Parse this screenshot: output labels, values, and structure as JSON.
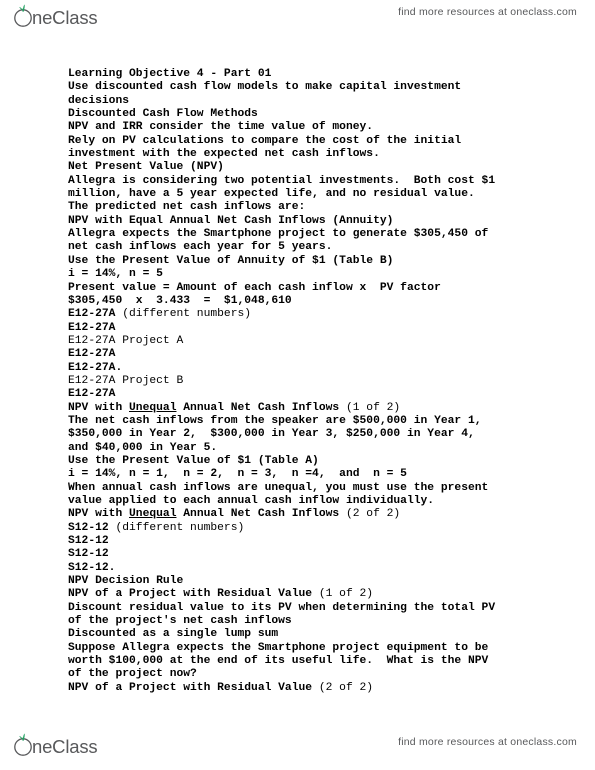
{
  "header": {
    "logo_text": "OneClass",
    "logo_icon": "oneclass-leaf-logo",
    "leaf_color": "#1f9f5f",
    "wordmark_color": "#58595b",
    "tagline": "find more resources at oneclass.com"
  },
  "footer": {
    "logo_text": "OneClass",
    "logo_icon": "oneclass-leaf-logo",
    "leaf_color": "#1f9f5f",
    "wordmark_color": "#58595b",
    "tagline": "find more resources at oneclass.com"
  },
  "document": {
    "lines": [
      {
        "style": "bold",
        "text": "Learning Objective 4 - Part 01"
      },
      {
        "style": "bold",
        "text": "Use discounted cash flow models to make capital investment"
      },
      {
        "style": "bold",
        "text": "decisions"
      },
      {
        "style": "bold",
        "text": "Discounted Cash Flow Methods"
      },
      {
        "style": "bold",
        "text": "NPV and IRR consider the time value of money."
      },
      {
        "style": "bold",
        "text": "Rely on PV calculations to compare the cost of the initial"
      },
      {
        "style": "bold",
        "text": "investment with the expected net cash inflows."
      },
      {
        "style": "bold",
        "text": "Net Present Value (NPV)"
      },
      {
        "style": "bold",
        "text": "Allegra is considering two potential investments.  Both cost $1"
      },
      {
        "style": "bold",
        "text": "million, have a 5 year expected life, and no residual value."
      },
      {
        "style": "bold",
        "text": "The predicted net cash inflows are:"
      },
      {
        "style": "bold",
        "text": "NPV with Equal Annual Net Cash Inflows (Annuity)"
      },
      {
        "style": "bold",
        "text": "Allegra expects the Smartphone project to generate $305,450 of"
      },
      {
        "style": "bold",
        "text": "net cash inflows each year for 5 years."
      },
      {
        "style": "bold",
        "text": "Use the Present Value of Annuity of $1 (Table B)"
      },
      {
        "style": "bold",
        "text": "i = 14%, n = 5"
      },
      {
        "style": "bold",
        "text": "Present value = Amount of each cash inflow x  PV factor"
      },
      {
        "style": "bold",
        "text": "$305,450  x  3.433  =  $1,048,610"
      },
      {
        "style": "mixed",
        "parts": [
          {
            "w": "bold",
            "text": "E12-27A "
          },
          {
            "w": "reg",
            "text": "(different numbers)"
          }
        ]
      },
      {
        "style": "bold",
        "text": "E12-27A"
      },
      {
        "style": "plain",
        "text": "E12-27A Project A"
      },
      {
        "style": "bold",
        "text": "E12-27A"
      },
      {
        "style": "bold",
        "text": "E12-27A."
      },
      {
        "style": "plain",
        "text": "E12-27A Project B"
      },
      {
        "style": "bold",
        "text": "E12-27A"
      },
      {
        "style": "mixed",
        "parts": [
          {
            "w": "bold",
            "text": "NPV with "
          },
          {
            "w": "bold-u",
            "text": "Unequal"
          },
          {
            "w": "bold",
            "text": " Annual Net Cash Inflows "
          },
          {
            "w": "reg",
            "text": "(1 of 2)"
          }
        ]
      },
      {
        "style": "bold",
        "text": "The net cash inflows from the speaker are $500,000 in Year 1,"
      },
      {
        "style": "bold",
        "text": "$350,000 in Year 2,  $300,000 in Year 3, $250,000 in Year 4,"
      },
      {
        "style": "bold",
        "text": "and $40,000 in Year 5."
      },
      {
        "style": "bold",
        "text": "Use the Present Value of $1 (Table A)"
      },
      {
        "style": "bold",
        "text": "i = 14%, n = 1,  n = 2,  n = 3,  n =4,  and  n = 5"
      },
      {
        "style": "bold",
        "text": "When annual cash inflows are unequal, you must use the present"
      },
      {
        "style": "bold",
        "text": "value applied to each annual cash inflow individually."
      },
      {
        "style": "mixed",
        "parts": [
          {
            "w": "bold",
            "text": "NPV with "
          },
          {
            "w": "bold-u",
            "text": "Unequal"
          },
          {
            "w": "bold",
            "text": " Annual Net Cash Inflows "
          },
          {
            "w": "reg",
            "text": "(2 of 2)"
          }
        ]
      },
      {
        "style": "mixed",
        "parts": [
          {
            "w": "bold",
            "text": "S12-12 "
          },
          {
            "w": "reg",
            "text": "(different numbers)"
          }
        ]
      },
      {
        "style": "bold",
        "text": "S12-12"
      },
      {
        "style": "bold",
        "text": "S12-12"
      },
      {
        "style": "bold",
        "text": "S12-12."
      },
      {
        "style": "bold",
        "text": "NPV Decision Rule"
      },
      {
        "style": "mixed",
        "parts": [
          {
            "w": "bold",
            "text": "NPV of a Project with Residual Value "
          },
          {
            "w": "reg",
            "text": "(1 of 2)"
          }
        ]
      },
      {
        "style": "bold",
        "text": "Discount residual value to its PV when determining the total PV"
      },
      {
        "style": "bold",
        "text": "of the project's net cash inflows"
      },
      {
        "style": "bold",
        "text": "Discounted as a single lump sum"
      },
      {
        "style": "bold",
        "text": "Suppose Allegra expects the Smartphone project equipment to be"
      },
      {
        "style": "bold",
        "text": "worth $100,000 at the end of its useful life.  What is the NPV"
      },
      {
        "style": "bold",
        "text": "of the project now?"
      },
      {
        "style": "mixed",
        "parts": [
          {
            "w": "bold",
            "text": "NPV of a Project with Residual Value "
          },
          {
            "w": "reg",
            "text": "(2 of 2)"
          }
        ]
      }
    ]
  }
}
